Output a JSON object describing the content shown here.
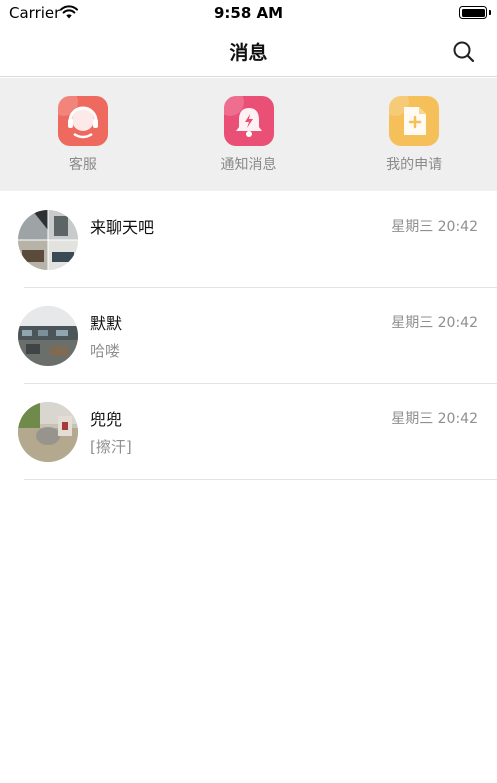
{
  "status_bar": {
    "carrier": "Carrier",
    "time": "9:58 AM"
  },
  "nav": {
    "title": "消息",
    "search_icon": "search-icon"
  },
  "shortcuts": [
    {
      "label": "客服",
      "icon": "customer-service-icon",
      "color": "#ee6a5f"
    },
    {
      "label": "通知消息",
      "icon": "notification-bell-icon",
      "color": "#ea4f76"
    },
    {
      "label": "我的申请",
      "icon": "application-document-icon",
      "color": "#f5c05a"
    }
  ],
  "messages": [
    {
      "name": "来聊天吧",
      "time": "星期三 20:42",
      "preview": ""
    },
    {
      "name": "默默",
      "time": "星期三 20:42",
      "preview": "哈喽"
    },
    {
      "name": "兜兜",
      "time": "星期三 20:42",
      "preview": "[擦汗]"
    }
  ]
}
